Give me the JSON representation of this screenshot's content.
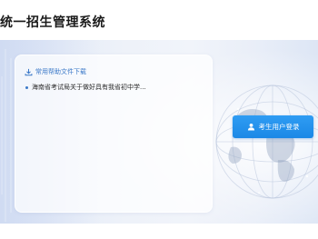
{
  "header": {
    "title": "统一招生管理系统"
  },
  "help_panel": {
    "title": "常用帮助文件下载",
    "items": [
      {
        "text": "海南省考试局关于做好具有我省初中学..."
      }
    ]
  },
  "login": {
    "label": "考生用户登录"
  },
  "colors": {
    "accent": "#2f9cf3",
    "link": "#3a78c8",
    "banner_bg": "#e9eef8"
  },
  "icons": {
    "download": "download-icon",
    "user": "user-icon",
    "bullet": "bullet-icon"
  }
}
